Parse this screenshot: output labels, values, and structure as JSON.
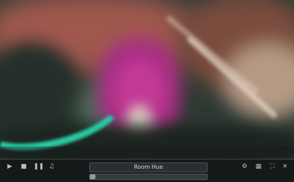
{
  "player": {
    "title": "Room Hue",
    "progress_fraction": 0.05
  },
  "toolbar": {
    "left_icons": [
      "play-icon",
      "stop-icon",
      "pause-icon",
      "volume-icon"
    ],
    "right_icons": [
      "settings-icon",
      "grid-icon",
      "fullscreen-icon",
      "close-icon"
    ]
  },
  "colors": {
    "magenta": "#a92f86",
    "teal": "#28c9a2",
    "toolbar_bg": "#16191a"
  }
}
